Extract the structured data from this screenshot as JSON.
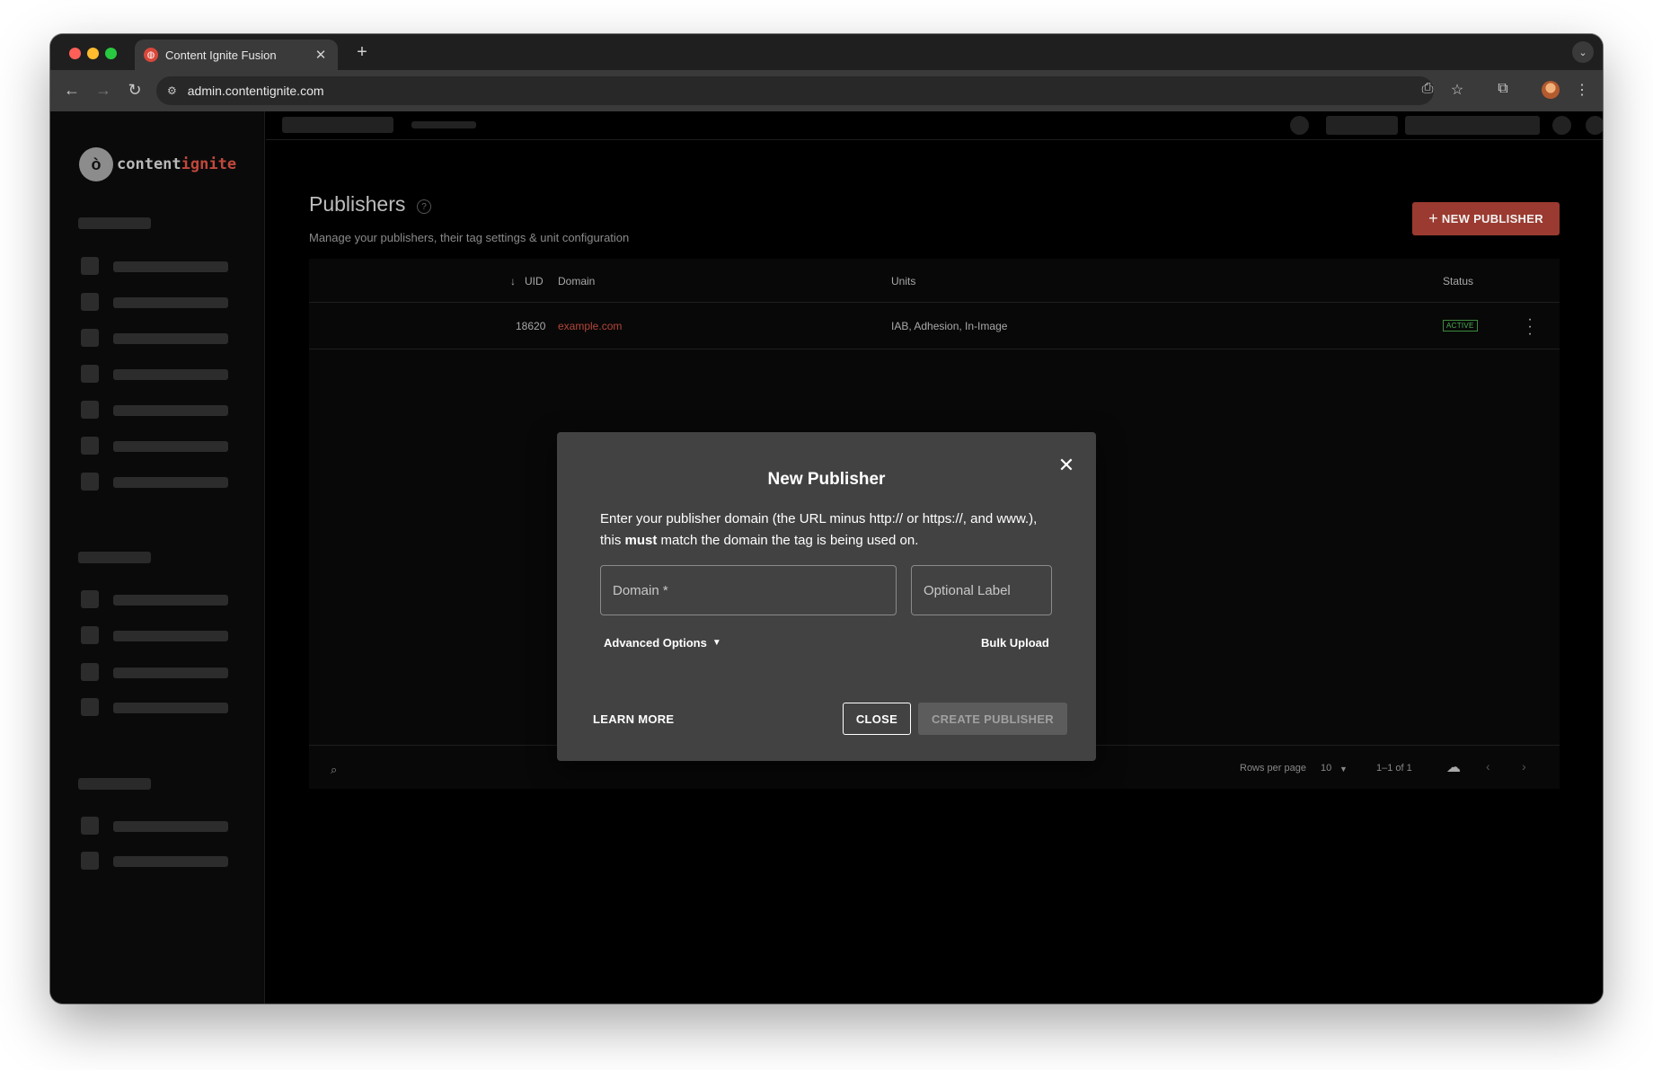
{
  "browser": {
    "tab_title": "Content Ignite Fusion",
    "url": "admin.contentignite.com"
  },
  "brand": {
    "logo_part1": "content",
    "logo_part2": "ignite",
    "accent_color": "#c0483c"
  },
  "page": {
    "title": "Publishers",
    "subtitle": "Manage your publishers, their tag settings & unit configuration",
    "new_button_label": "NEW PUBLISHER"
  },
  "table": {
    "columns": [
      "UID",
      "Domain",
      "Units",
      "Status"
    ],
    "rows": [
      {
        "uid": "18620",
        "domain": "example.com",
        "units": "IAB, Adhesion, In-Image",
        "status": "ACTIVE"
      }
    ],
    "footer": {
      "rows_per_page_label": "Rows per page",
      "rows_per_page_value": "10",
      "pagination": "1–1 of 1"
    }
  },
  "modal": {
    "title": "New Publisher",
    "desc_part1": "Enter your publisher domain (the URL minus http:// or https://, and www.), this ",
    "desc_bold": "must",
    "desc_part2": " match the domain the tag is being used on.",
    "domain_placeholder": "Domain *",
    "label_placeholder": "Optional Label",
    "advanced_options": "Advanced Options",
    "bulk_upload": "Bulk Upload",
    "learn_more": "LEARN MORE",
    "close": "CLOSE",
    "create": "CREATE PUBLISHER"
  }
}
